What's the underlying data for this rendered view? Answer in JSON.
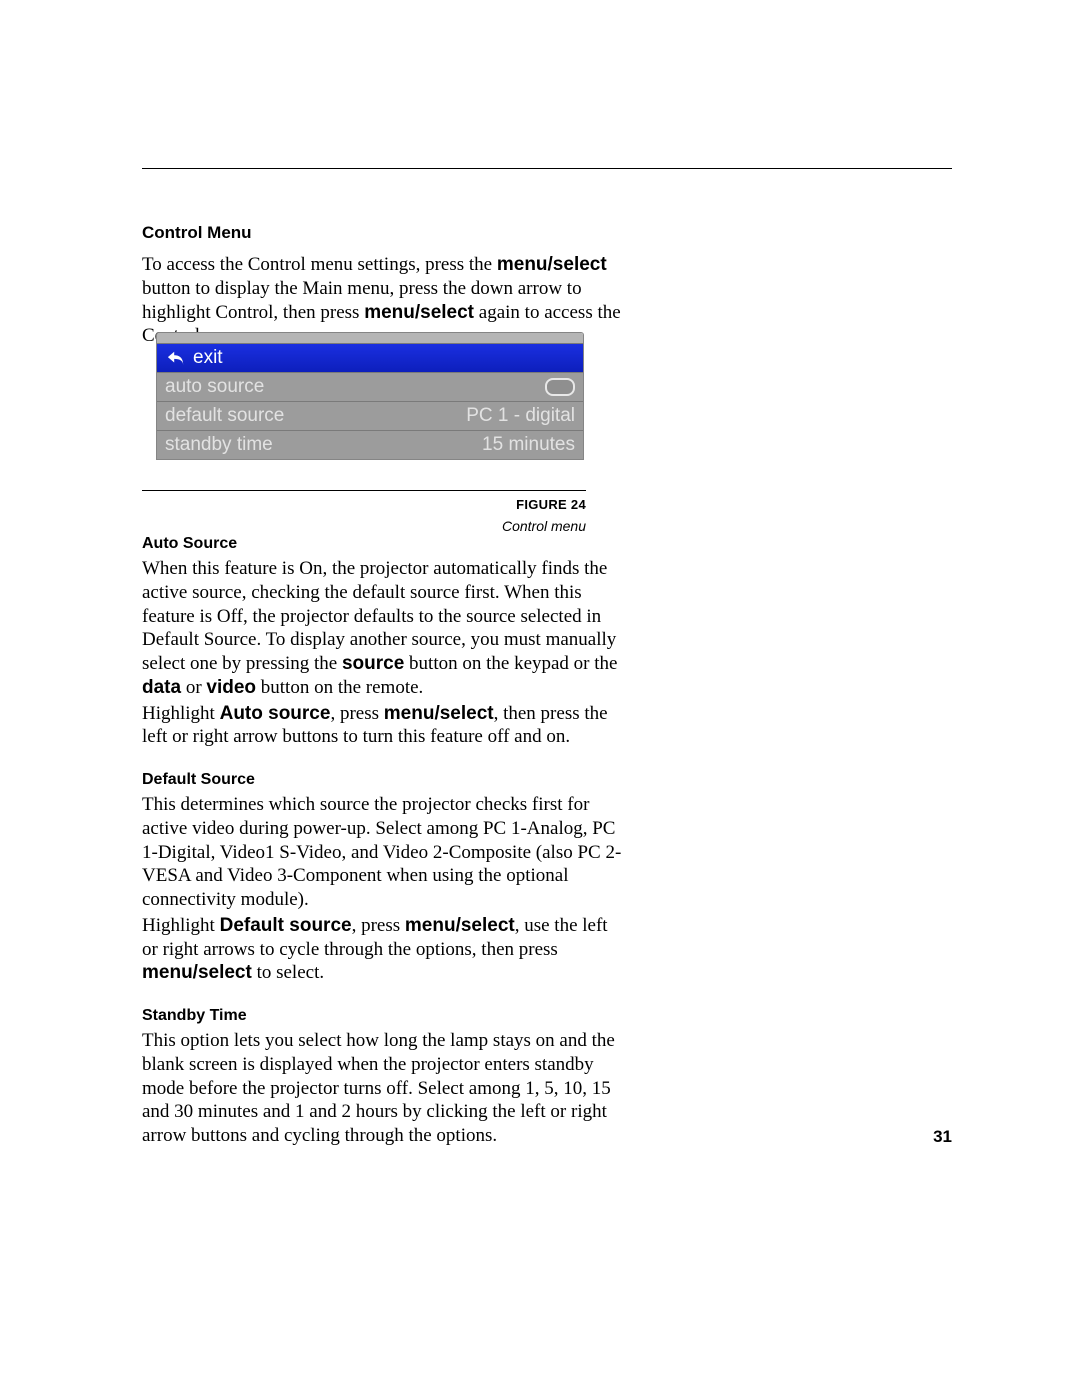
{
  "page_number": "31",
  "sections": {
    "control_menu": {
      "heading": "Control Menu",
      "intro_parts": [
        "To access the Control menu settings, press the ",
        "menu/select",
        " button to display the Main menu, press the down arrow to highlight Control, then press ",
        "menu/select",
        " again to access the Control menu."
      ]
    },
    "auto_source": {
      "heading": "Auto Source",
      "para1_parts": [
        "When this feature is On, the projector automatically finds the active source, checking the default source first. When this feature is Off, the projector defaults to the source selected in Default Source. To display another source, you must manually select one by pressing the ",
        "source",
        " button on the keypad or the ",
        "data",
        " or ",
        "video",
        " button on the remote."
      ],
      "para2_parts": [
        "Highlight ",
        "Auto source",
        ", press ",
        "menu/select",
        ", then press the left or right arrow buttons to turn this feature off and on."
      ]
    },
    "default_source": {
      "heading": "Default Source",
      "para1": "This determines which source the projector checks first for active video during power-up. Select among PC 1-Analog, PC 1-Digital, Video1 S-Video, and Video 2-Composite (also PC 2-VESA and Video 3-Component when using the optional connectivity module).",
      "para2_parts": [
        "Highlight ",
        "Default source",
        ", press ",
        "menu/select",
        ", use the left or right arrows to cycle through the options, then press ",
        "menu/select",
        " to select."
      ]
    },
    "standby_time": {
      "heading": "Standby Time",
      "para1": "This option lets you select how long the lamp stays on and the blank screen is displayed when the projector enters standby mode before the projector turns off. Select among 1, 5, 10, 15 and 30 minutes and 1 and 2 hours by clicking the left or right arrow buttons and cycling through the options."
    }
  },
  "figure": {
    "label": "FIGURE 24",
    "caption": "Control menu"
  },
  "osd": {
    "exit_label": "exit",
    "rows": [
      {
        "label": "auto source",
        "value_type": "toggle"
      },
      {
        "label": "default source",
        "value": "PC 1 - digital"
      },
      {
        "label": "standby time",
        "value": "15 minutes"
      }
    ]
  }
}
